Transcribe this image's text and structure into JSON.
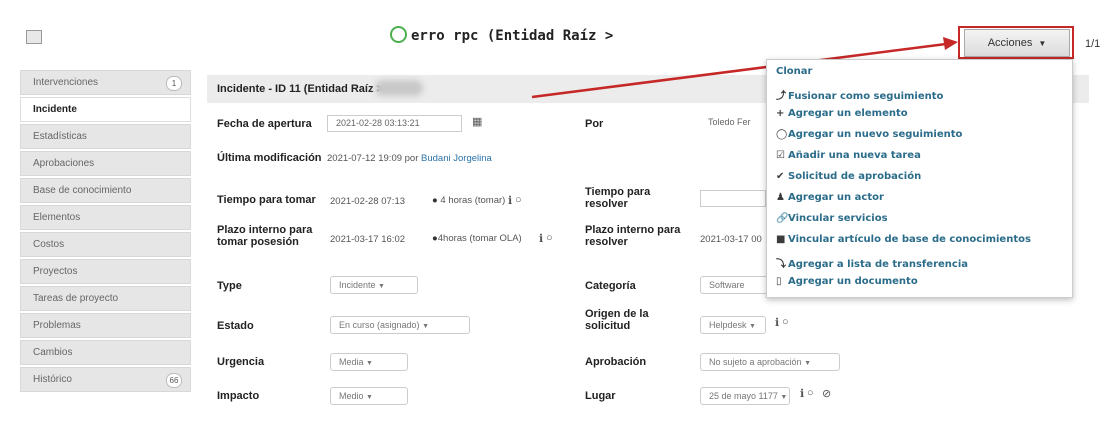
{
  "header": {
    "title": "erro rpc (Entidad Raíz >",
    "actions_label": "Acciones",
    "pager": "1/1"
  },
  "sidebar": {
    "items": [
      {
        "label": "Intervenciones",
        "badge": "1"
      },
      {
        "label": "Incidente",
        "badge": ""
      },
      {
        "label": "Estadísticas",
        "badge": ""
      },
      {
        "label": "Aprobaciones",
        "badge": ""
      },
      {
        "label": "Base de conocimiento",
        "badge": ""
      },
      {
        "label": "Elementos",
        "badge": ""
      },
      {
        "label": "Costos",
        "badge": ""
      },
      {
        "label": "Proyectos",
        "badge": ""
      },
      {
        "label": "Tareas de proyecto",
        "badge": ""
      },
      {
        "label": "Problemas",
        "badge": ""
      },
      {
        "label": "Cambios",
        "badge": ""
      },
      {
        "label": "Histórico",
        "badge": "66"
      }
    ]
  },
  "form": {
    "header": "Incidente - ID 11 (Entidad Raíz >",
    "fecha_apertura_label": "Fecha de apertura",
    "fecha_apertura_value": "2021-02-28 03:13:21",
    "por_label": "Por",
    "por_value": "Toledo Fer",
    "ultima_mod_label": "Última modificación",
    "ultima_mod_value": "2021-07-12 19:09 por",
    "ultima_mod_user": "Budani Jorgelina",
    "tiempo_tomar_label": "Tiempo para tomar",
    "tiempo_tomar_value": "2021-02-28 07:13",
    "tiempo_tomar_note": "4 horas (tomar)",
    "tiempo_resolver_label": "Tiempo para resolver",
    "plazo_posesion_label": "Plazo interno para tomar posesión",
    "plazo_posesion_value": "2021-03-17 16:02",
    "plazo_posesion_note": "4horas (tomar OLA)",
    "plazo_resolver_label": "Plazo interno para resolver",
    "plazo_resolver_value": "2021-03-17 00",
    "type_label": "Type",
    "type_value": "Incidente",
    "categoria_label": "Categoría",
    "categoria_value": "Software",
    "estado_label": "Estado",
    "estado_value": "En curso (asignado)",
    "origen_label": "Origen de la solicitud",
    "origen_value": "Helpdesk",
    "urgencia_label": "Urgencia",
    "urgencia_value": "Media",
    "aprobacion_label": "Aprobación",
    "aprobacion_value": "No sujeto a aprobación",
    "impacto_label": "Impacto",
    "impacto_value": "Medio",
    "lugar_label": "Lugar",
    "lugar_value": "25 de mayo 1177"
  },
  "actions_menu": [
    {
      "icon": "",
      "label": "Clonar"
    },
    {
      "icon": "⤴",
      "label": "Fusionar como seguimiento"
    },
    {
      "icon": "+",
      "label": "Agregar un elemento"
    },
    {
      "icon": "◯",
      "label": "Agregar un nuevo seguimiento"
    },
    {
      "icon": "☑",
      "label": "Añadir una nueva tarea"
    },
    {
      "icon": "✔",
      "label": "Solicitud de aprobación"
    },
    {
      "icon": "♟",
      "label": "Agregar un actor"
    },
    {
      "icon": "🔗",
      "label": "Vincular servicios"
    },
    {
      "icon": "■",
      "label": "Vincular artículo de base de conocimientos"
    },
    {
      "icon": "⤵",
      "label": "Agregar a lista de transferencia"
    },
    {
      "icon": "▯",
      "label": "Agregar un documento"
    }
  ],
  "colors": {
    "annotation_red": "#c62828",
    "link_blue": "#2a73a8",
    "menu_text": "#2b6c8a"
  }
}
